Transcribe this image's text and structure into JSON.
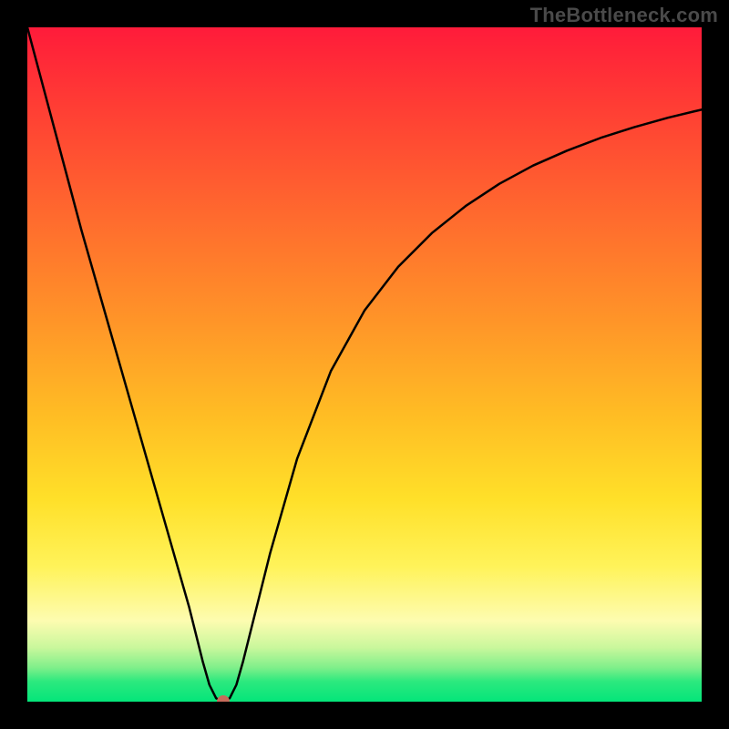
{
  "watermark": "TheBottleneck.com",
  "chart_data": {
    "type": "line",
    "title": "",
    "xlabel": "",
    "ylabel": "",
    "xlim": [
      0,
      100
    ],
    "ylim": [
      0,
      100
    ],
    "x": [
      0,
      4,
      8,
      12,
      16,
      20,
      24,
      26,
      27,
      28,
      29,
      30,
      31,
      32,
      34,
      36,
      40,
      45,
      50,
      55,
      60,
      65,
      70,
      75,
      80,
      85,
      90,
      95,
      100
    ],
    "values": [
      100,
      85,
      70,
      56,
      42,
      28,
      14,
      6,
      2.5,
      0.5,
      0,
      0.5,
      2.5,
      6,
      14,
      22,
      36,
      49,
      58,
      64.5,
      69.5,
      73.5,
      76.8,
      79.5,
      81.7,
      83.6,
      85.2,
      86.6,
      87.8
    ],
    "background_gradient": {
      "direction": "vertical",
      "stops": [
        {
          "pos": 0.0,
          "color": "#ff1b3a"
        },
        {
          "pos": 0.12,
          "color": "#ff3e34"
        },
        {
          "pos": 0.28,
          "color": "#ff6a2e"
        },
        {
          "pos": 0.44,
          "color": "#ff9628"
        },
        {
          "pos": 0.58,
          "color": "#ffbe24"
        },
        {
          "pos": 0.7,
          "color": "#ffe029"
        },
        {
          "pos": 0.8,
          "color": "#fff35a"
        },
        {
          "pos": 0.88,
          "color": "#fdfcb0"
        },
        {
          "pos": 0.92,
          "color": "#c9f79c"
        },
        {
          "pos": 0.95,
          "color": "#7eef8a"
        },
        {
          "pos": 0.97,
          "color": "#2ce97e"
        },
        {
          "pos": 1.0,
          "color": "#04e57a"
        }
      ]
    },
    "marker": {
      "x": 29,
      "y": 0,
      "color": "#c76b5a"
    },
    "border_color": "#000000",
    "curve_color": "#000000"
  }
}
